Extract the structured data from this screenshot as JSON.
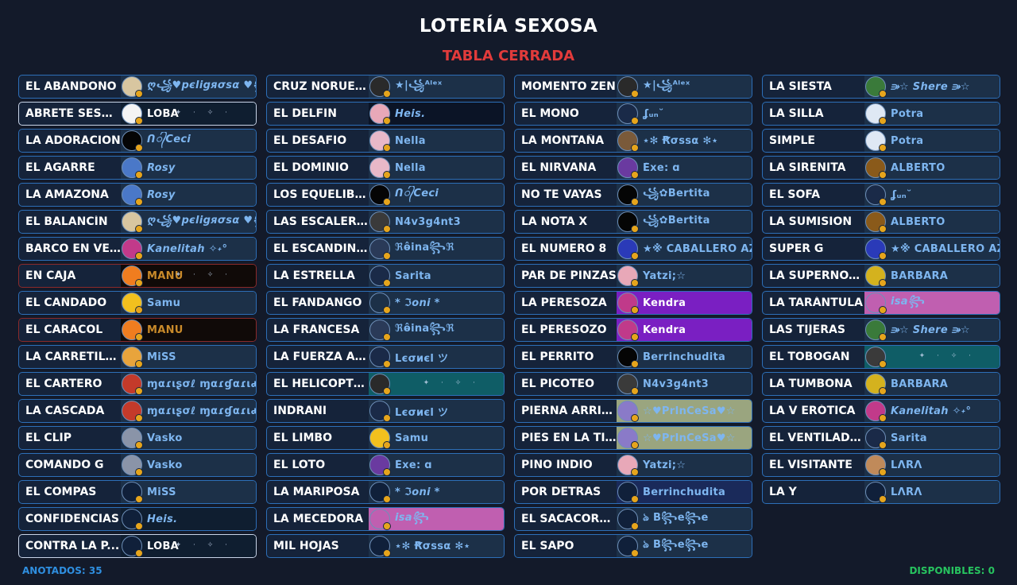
{
  "header": {
    "title": "LOTERÍA SEXOSA",
    "status": "TABLA CERRADA"
  },
  "footer": {
    "annotated": "ANOTADOS: 35",
    "available": "DISPONIBLES: 0"
  },
  "colors": {
    "accent": "#2d6fb8",
    "status_red": "#e23b3b",
    "annotated_blue": "#2f8fe0",
    "available_green": "#27c45f",
    "purple": "#7a1fc2",
    "pink": "#c05fb0",
    "teal": "#0f5d66",
    "olive": "#9aa57f"
  },
  "columns": [
    [
      {
        "card": "EL ABANDONO",
        "player": "ღ꧁♥pєligяσѕα ♥꧂ღ",
        "avatar": "#d8c6a0",
        "style": "italic"
      },
      {
        "card": "ABRETE SESA...",
        "player": "LOBA",
        "avatar": "#f4f4f4",
        "style": "white",
        "bg": "#0f1e30",
        "selected": true,
        "sparkle": true
      },
      {
        "card": "LA ADORACION",
        "player": "ᑎ᭄Ceci",
        "avatar": "#050505",
        "style": "italic"
      },
      {
        "card": "EL AGARRE",
        "player": "Rosy",
        "avatar": "#4a78c8",
        "style": "italic"
      },
      {
        "card": "LA AMAZONA",
        "player": "Rosy",
        "avatar": "#4a78c8",
        "style": "italic"
      },
      {
        "card": "EL BALANCÍN",
        "player": "ღ꧁♥pєligяσѕα ♥꧂ღ",
        "avatar": "#d8c6a0",
        "style": "italic"
      },
      {
        "card": "BARCO EN VELA",
        "player": "Kanelitah ✧˖°",
        "avatar": "#c23a8a",
        "style": "italic"
      },
      {
        "card": "EN CAJA",
        "player": "MANU",
        "avatar": "#f07d1f",
        "style": "gold",
        "bg": "#100a08",
        "redborder": true,
        "sparkle": true
      },
      {
        "card": "EL CANDADO",
        "player": "Samu",
        "avatar": "#f2c01e"
      },
      {
        "card": "EL CARACOL",
        "player": "MANU",
        "avatar": "#f07d1f",
        "style": "gold",
        "bg": "#100a08",
        "redborder": true
      },
      {
        "card": "LA CARRETILLA",
        "player": "MiSS",
        "avatar": "#e8a43c"
      },
      {
        "card": "EL CARTERO",
        "player": "ɱαɾιʂσℓ ɱαɾɠαɾιԃα",
        "avatar": "#c43a2a"
      },
      {
        "card": "LA CASCADA",
        "player": "ɱαɾιʂσℓ ɱαɾɠαɾιԃα",
        "avatar": "#c43a2a"
      },
      {
        "card": "EL CLIP",
        "player": "Vasko",
        "avatar": "#8a94a8"
      },
      {
        "card": "COMANDO G",
        "player": "Vasko",
        "avatar": "#8a94a8"
      },
      {
        "card": "EL COMPAS",
        "player": "MiSS",
        "avatar": "#10203a"
      },
      {
        "card": "CONFIDENCIAS",
        "player": "Heis.",
        "avatar": "#10203a",
        "style": "italic",
        "bg": "#0f1e30"
      },
      {
        "card": "CONTRA LA P...",
        "player": "LOBA",
        "avatar": "#10203a",
        "style": "white",
        "bg": "#0f1e30",
        "selected": true,
        "sparkle": true
      }
    ],
    [
      {
        "card": "CRUZ NORUEGA",
        "player": "★|꧁ᴬˡᵉˣ",
        "avatar": "#2a2a2a"
      },
      {
        "card": "EL DELFIN",
        "player": "Heis.",
        "avatar": "#e8a8b8",
        "style": "italic",
        "bg": "#0b1426"
      },
      {
        "card": "EL DESAFIO",
        "player": "Nella",
        "avatar": "#e8b8c8"
      },
      {
        "card": "EL DOMINIO",
        "player": "Nella",
        "avatar": "#e8b8c8"
      },
      {
        "card": "LOS EQUELIBRI...",
        "player": "ᑎ᭄Ceci",
        "avatar": "#050505",
        "style": "italic"
      },
      {
        "card": "LAS ESCALERAS",
        "player": "N4v3g4nt3",
        "avatar": "#3a3a3a"
      },
      {
        "card": "EL ESCANDINA...",
        "player": "ℜⱺ̂ina꧂ℜ",
        "avatar": "#2a3a58"
      },
      {
        "card": "LA ESTRELLA",
        "player": "Sarita",
        "avatar": "#1a2a48"
      },
      {
        "card": "EL FANDANGO",
        "player": "* ℑoni *",
        "avatar": "#1c3048",
        "style": "italic"
      },
      {
        "card": "LA FRANCESA",
        "player": "ℜⱺ̂ina꧂ℜ",
        "avatar": "#2a3a58"
      },
      {
        "card": "LA FUERZA AE...",
        "player": "Lєσиєl ツ",
        "avatar": "#1a2a48"
      },
      {
        "card": "EL HELICOPTERO",
        "player": "",
        "avatar": "#2a2a2a",
        "bg": "#0f5d66",
        "sparkle": true
      },
      {
        "card": "INDRANI",
        "player": "Lєσиєl ツ",
        "avatar": "#1a2a48"
      },
      {
        "card": "EL LIMBO",
        "player": "Samu",
        "avatar": "#f2c01e"
      },
      {
        "card": "EL LOTO",
        "player": "Ěxe: ɑ",
        "avatar": "#6a3aa0"
      },
      {
        "card": "LA MARIPOSA",
        "player": "* ℑoni *",
        "avatar": "#10203a",
        "style": "italic"
      },
      {
        "card": "LA MECEDORA",
        "player": "isa꧂",
        "avatar": "#c05fb0",
        "style": "italic",
        "bg": "#c05fb0"
      },
      {
        "card": "MIL HOJAS",
        "player": "⋆✻ Ꞧσѕѕα ✻⋆",
        "avatar": "#10203a"
      }
    ],
    [
      {
        "card": "MOMENTO ZEN",
        "player": "★|꧁ᴬˡᵉˣ",
        "avatar": "#2a2a2a"
      },
      {
        "card": "EL MONO",
        "player": "ʆᵤₙ˘",
        "avatar": "#1a2a48"
      },
      {
        "card": "LA MONTAÑA",
        "player": "⋆✻ Ꞧσѕѕα ✻⋆",
        "avatar": "#7a5a3a"
      },
      {
        "card": "EL NIRVANA",
        "player": "Ěxe: ɑ",
        "avatar": "#6a3aa0"
      },
      {
        "card": "NO TE VAYAS",
        "player": "꧁✿Bertita",
        "avatar": "#050505"
      },
      {
        "card": "LA NOTA X",
        "player": "꧁✿Bertita",
        "avatar": "#050505"
      },
      {
        "card": "EL NUMERO 8",
        "player": "★※ CABALLERO AZUL",
        "avatar": "#2a3ab8"
      },
      {
        "card": "PAR DE PINZAS",
        "player": "Yatzi;☆",
        "avatar": "#e8a8b8"
      },
      {
        "card": "LA PERESOZA",
        "player": "Kendra",
        "avatar": "#c03a8a",
        "style": "white",
        "bg": "#7a1fc2"
      },
      {
        "card": "EL PERESOZO",
        "player": "Kendra",
        "avatar": "#c03a8a",
        "style": "white",
        "bg": "#7a1fc2"
      },
      {
        "card": "EL PERRITO",
        "player": "Berrinchudita",
        "avatar": "#050505"
      },
      {
        "card": "EL PICOTEO",
        "player": "N4v3g4nt3",
        "avatar": "#3a3a3a"
      },
      {
        "card": "PIERNA ARRIBA",
        "player": "☆♥PrInCeSa♥☆",
        "avatar": "#8a7ac8",
        "bg": "#9aa57f"
      },
      {
        "card": "PIES EN LA TIE...",
        "player": "☆♥PrInCeSa♥☆",
        "avatar": "#8a7ac8",
        "bg": "#9aa57f"
      },
      {
        "card": "PINO INDIO",
        "player": "Yatzi;☆",
        "avatar": "#e8a8b8"
      },
      {
        "card": "POR DETRAS",
        "player": "Berrinchudita",
        "avatar": "#10203a",
        "bg": "#1a2a5a"
      },
      {
        "card": "EL SACACORC...",
        "player": "ঌ B꧂e꧂e",
        "avatar": "#10203a"
      },
      {
        "card": "EL SAPO",
        "player": "ঌ B꧂e꧂e",
        "avatar": "#10203a"
      }
    ],
    [
      {
        "card": "LA SIESTA",
        "player": "⭄☆ Shere ⭄☆",
        "avatar": "#3a7a3a",
        "style": "italic"
      },
      {
        "card": "LA SILLA",
        "player": "Potra",
        "avatar": "#dfe8f4"
      },
      {
        "card": "SIMPLE",
        "player": "Potra",
        "avatar": "#dfe8f4"
      },
      {
        "card": "LA SIRENITA",
        "player": "ALBERTO",
        "avatar": "#8a5a1a"
      },
      {
        "card": "EL SOFA",
        "player": "ʆᵤₙ˘",
        "avatar": "#1a2a48"
      },
      {
        "card": "LA SUMISION",
        "player": "ALBERTO",
        "avatar": "#8a5a1a"
      },
      {
        "card": "SUPER G",
        "player": "★※ CABALLERO AZUL",
        "avatar": "#2a3ab8"
      },
      {
        "card": "LA SUPERNOVA",
        "player": "BARBARA",
        "avatar": "#d4b21e"
      },
      {
        "card": "LA TARÁNTULA",
        "player": "isa꧂",
        "avatar": "#c05fb0",
        "style": "italic",
        "bg": "#c05fb0"
      },
      {
        "card": "LAS TIJERAS",
        "player": "⭄☆ Shere ⭄☆",
        "avatar": "#3a7a3a",
        "style": "italic"
      },
      {
        "card": "EL TOBOGAN",
        "player": "",
        "avatar": "#3a3a3a",
        "bg": "#0f5d66",
        "sparkle": true
      },
      {
        "card": "LA TUMBONA",
        "player": "BARBARA",
        "avatar": "#d4b21e"
      },
      {
        "card": "LA V ERÓTICA",
        "player": "Kanelitah ✧˖°",
        "avatar": "#c23a8a",
        "style": "italic"
      },
      {
        "card": "EL VENTILADOR",
        "player": "Sarita",
        "avatar": "#1a2a48"
      },
      {
        "card": "EL VISITANTE",
        "player": "LΛRΛ",
        "avatar": "#c08a5a"
      },
      {
        "card": "LA Y",
        "player": "LΛRΛ",
        "avatar": "#10203a"
      }
    ]
  ]
}
